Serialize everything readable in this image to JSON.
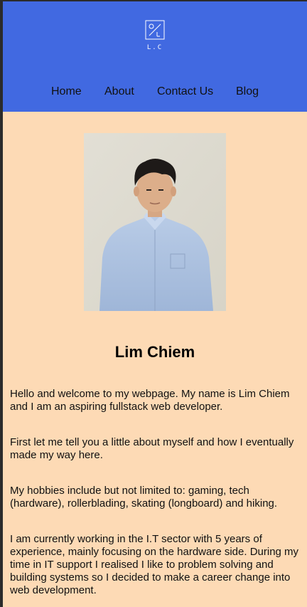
{
  "header": {
    "logo_text": "L.C",
    "nav": [
      {
        "label": "Home"
      },
      {
        "label": "About"
      },
      {
        "label": "Contact Us"
      },
      {
        "label": "Blog"
      }
    ]
  },
  "profile": {
    "name": "Lim Chiem",
    "paragraphs": [
      "Hello and welcome to my webpage. My name is Lim Chiem and I am an aspiring fullstack web developer.",
      "First let me tell you a little about myself and how I eventually made my way here.",
      "My hobbies include but not limited to: gaming, tech (hardware), rollerblading, skating (longboard) and hiking.",
      "I am currently working in the I.T sector with 5 years of experience, mainly focusing on the hardware side. During my time in IT support I realised I like to problem solving and building systems so I decided to make a career change into web development."
    ]
  },
  "colors": {
    "header_bg": "#4169e1",
    "page_bg": "#fddab5"
  }
}
